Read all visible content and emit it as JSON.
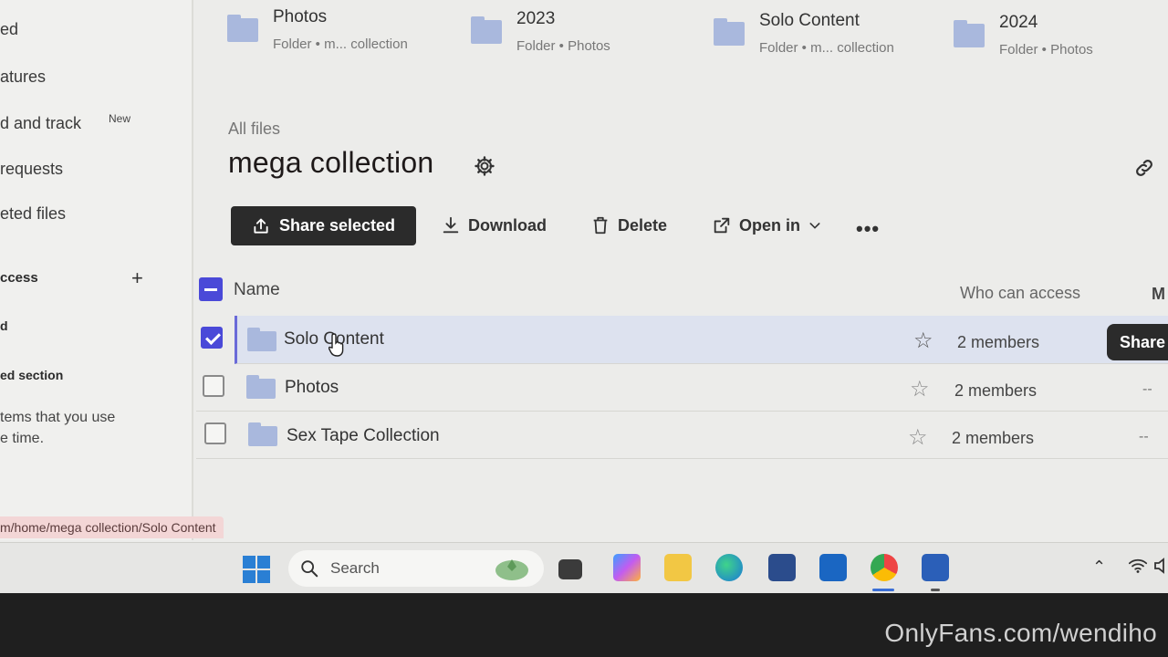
{
  "sidebar": {
    "items": [
      {
        "label": "ed"
      },
      {
        "label": "atures"
      },
      {
        "label": "d and track",
        "badge": "New"
      },
      {
        "label": " requests"
      },
      {
        "label": "eted files"
      }
    ],
    "access_heading": "ccess",
    "sub_item": "d",
    "section_heading": "ed section",
    "hint_line1": "tems that you use",
    "hint_line2": "e time."
  },
  "suggested": [
    {
      "name": "Photos",
      "subtitle": "Folder • m... collection"
    },
    {
      "name": "2023",
      "subtitle": "Folder • Photos"
    },
    {
      "name": "Solo Content",
      "subtitle": "Folder • m... collection"
    },
    {
      "name": "2024",
      "subtitle": "Folder • Photos"
    }
  ],
  "breadcrumb": "All files",
  "page_title": "mega collection",
  "toolbar": {
    "share_selected": "Share selected",
    "download": "Download",
    "delete": "Delete",
    "open_in": "Open in",
    "more": "•••"
  },
  "table": {
    "col_name": "Name",
    "col_access": "Who can access",
    "col_m": "M",
    "rows": [
      {
        "name": "Solo Content",
        "access": "2 members",
        "extra": "",
        "selected": true,
        "starred": false
      },
      {
        "name": "Photos",
        "access": "2 members",
        "extra": "--",
        "selected": false,
        "starred": false
      },
      {
        "name": "Sex Tape Collection",
        "access": "2 members",
        "extra": "--",
        "selected": false,
        "starred": false
      }
    ],
    "hover_button": "Share"
  },
  "status_url": "m/home/mega collection/Solo Content",
  "taskbar": {
    "search_placeholder": "Search",
    "apps": [
      "start-icon",
      "task-view-icon",
      "copilot-icon",
      "file-explorer-icon",
      "edge-icon",
      "store-icon",
      "outlook-icon",
      "chrome-icon",
      "word-icon"
    ],
    "tray": [
      "chevron-up-icon",
      "wifi-icon",
      "speaker-icon"
    ]
  },
  "watermark": "OnlyFans.com/wendiho",
  "colors": {
    "accent": "#4a49d8",
    "folder": "#a9b8dd",
    "dark_button": "#2b2b2b",
    "selected_row": "#dde2ef"
  }
}
